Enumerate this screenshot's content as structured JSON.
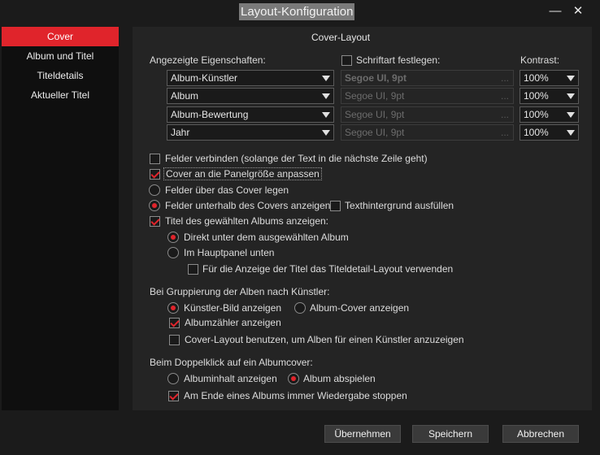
{
  "window": {
    "title": "Layout-Konfiguration",
    "minimize_symbol": "—",
    "close_symbol": "✕"
  },
  "sidebar": {
    "items": [
      {
        "label": "Cover"
      },
      {
        "label": "Album und Titel"
      },
      {
        "label": "Titeldetails"
      },
      {
        "label": "Aktueller Titel"
      }
    ]
  },
  "main": {
    "heading": "Cover-Layout",
    "fields_label": "Angezeigte Eigenschaften:",
    "font_label": "Schriftart festlegen:",
    "font_checked": false,
    "contrast_label": "Kontrast:",
    "rows": [
      {
        "property": "Album-Künstler",
        "font": "Segoe UI, 9pt",
        "font_dots": "...",
        "contrast": "100%"
      },
      {
        "property": "Album",
        "font": "Segoe UI, 9pt",
        "font_dots": "...",
        "contrast": "100%"
      },
      {
        "property": "Album-Bewertung",
        "font": "Segoe UI, 9pt",
        "font_dots": "...",
        "contrast": "100%"
      },
      {
        "property": "Jahr",
        "font": "Segoe UI, 9pt",
        "font_dots": "...",
        "contrast": "100%"
      }
    ],
    "options": {
      "join_fields": {
        "label": "Felder verbinden (solange der Text in die nächste Zeile geht)",
        "checked": false
      },
      "fit_cover": {
        "label": "Cover an die Panelgröße anpassen",
        "checked": true
      },
      "overlay_fields": {
        "label": "Felder über das Cover legen",
        "selected": false
      },
      "fields_below": {
        "label": "Felder unterhalb des Covers anzeigen",
        "selected": true
      },
      "fill_background": {
        "label": "Texthintergrund ausfüllen",
        "checked": false
      },
      "show_titles": {
        "label": "Titel des gewählten Albums anzeigen:",
        "checked": true
      },
      "below_selected": {
        "label": "Direkt unter dem ausgewählten Album",
        "selected": true
      },
      "main_panel": {
        "label": "Im Hauptpanel unten",
        "selected": false
      },
      "use_detail_layout": {
        "label": "Für die Anzeige der Titel das Titeldetail-Layout verwenden",
        "checked": false
      }
    },
    "artist_group": {
      "heading": "Bei Gruppierung der Alben nach Künstler:",
      "artist_image": {
        "label": "Künstler-Bild anzeigen",
        "selected": true
      },
      "album_cover": {
        "label": "Album-Cover anzeigen",
        "selected": false
      },
      "album_counter": {
        "label": "Albumzähler anzeigen",
        "checked": true
      },
      "cover_layout": {
        "label": "Cover-Layout benutzen, um Alben für einen Künstler anzuzeigen",
        "checked": false
      }
    },
    "doubleclick_group": {
      "heading": "Beim Doppelklick auf ein Albumcover:",
      "show_content": {
        "label": "Albuminhalt anzeigen",
        "selected": false
      },
      "play_album": {
        "label": "Album abspielen",
        "selected": true
      },
      "stop_playback": {
        "label": "Am Ende eines Albums immer Wiedergabe stoppen",
        "checked": true
      }
    }
  },
  "buttons": {
    "apply": "Übernehmen",
    "save": "Speichern",
    "cancel": "Abbrechen"
  },
  "colors": {
    "accent": "#e0242b",
    "background": "#1b1b1b",
    "panel": "#242424"
  }
}
